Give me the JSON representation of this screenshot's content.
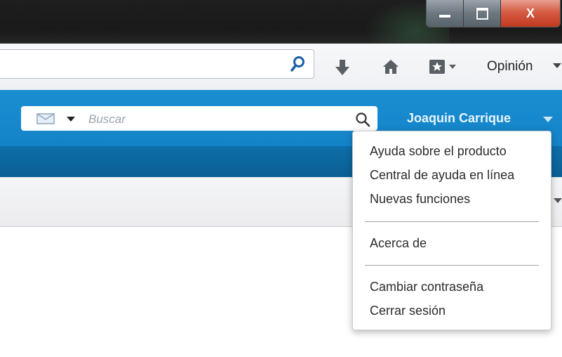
{
  "window": {
    "minimize_icon": "minimize-icon",
    "maximize_icon": "restore-icon",
    "close_label": "X"
  },
  "browser_toolbar": {
    "url_value": "",
    "search_icon": "search-icon",
    "download_icon": "download-arrow-icon",
    "home_icon": "home-icon",
    "bookmark_icon": "bookmark-star-icon",
    "opinion_label": "Opinión"
  },
  "app_header": {
    "search": {
      "scope_icon": "mail-icon",
      "placeholder": "Buscar"
    },
    "user_name": "Joaquin Carrique"
  },
  "user_menu": {
    "items": [
      "Ayuda sobre el producto",
      "Central de ayuda en línea",
      "Nuevas funciones",
      "Acerca de",
      "Cambiar contraseña",
      "Cerrar sesión"
    ]
  },
  "colors": {
    "header_blue": "#1a8ed2",
    "subnav_blue": "#0b5f94",
    "close_red": "#d65c44"
  }
}
